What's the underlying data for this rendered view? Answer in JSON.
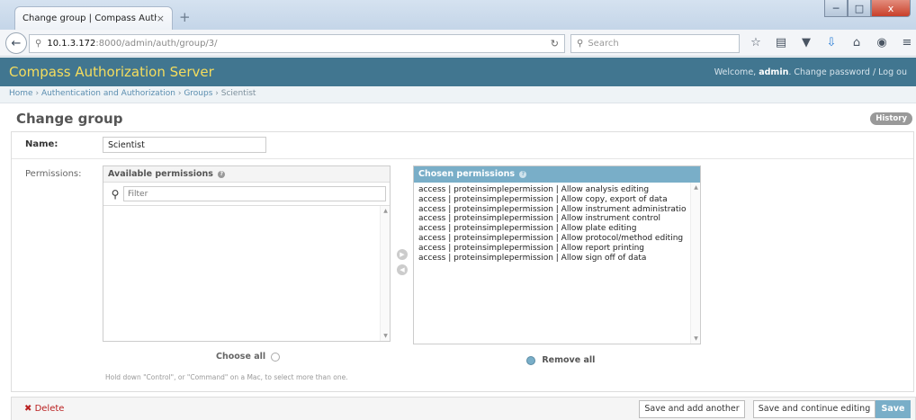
{
  "browser": {
    "tab_title": "Change group | Compass Auth...",
    "tab_close": "×",
    "new_tab": "+",
    "url_host": "10.1.3.172",
    "url_path": ":8000/admin/auth/group/3/",
    "search_placeholder": "Search",
    "win_min": "─",
    "win_max": "□",
    "win_close": "x"
  },
  "header": {
    "branding": "Compass Authorization Server",
    "welcome": "Welcome,",
    "username": "admin",
    "change_password": "Change password",
    "separator": "/",
    "logout": "Log ou"
  },
  "breadcrumbs": {
    "home": "Home",
    "app": "Authentication and Authorization",
    "model": "Groups",
    "current": "Scientist",
    "sep": "›"
  },
  "page": {
    "title": "Change group",
    "history": "History"
  },
  "form": {
    "name_label": "Name:",
    "name_value": "Scientist",
    "permissions_label": "Permissions:",
    "available_title": "Available permissions",
    "filter_placeholder": "Filter",
    "chosen_title": "Chosen permissions",
    "chosen_items": [
      "access | proteinsimplepermission | Allow analysis editing",
      "access | proteinsimplepermission | Allow copy, export of data",
      "access | proteinsimplepermission | Allow instrument administratio",
      "access | proteinsimplepermission | Allow instrument control",
      "access | proteinsimplepermission | Allow plate editing",
      "access | proteinsimplepermission | Allow protocol/method editing",
      "access | proteinsimplepermission | Allow report printing",
      "access | proteinsimplepermission | Allow sign off of data"
    ],
    "choose_all": "Choose all",
    "remove_all": "Remove all",
    "help_text": "Hold down \"Control\", or \"Command\" on a Mac, to select more than one."
  },
  "submit": {
    "delete": "Delete",
    "save_add_another": "Save and add another",
    "save_continue": "Save and continue editing",
    "save": "Save"
  },
  "colors": {
    "header_bg": "#417690",
    "branding": "#f5dd5d",
    "accent": "#79aec8",
    "delete": "#ba2121"
  }
}
